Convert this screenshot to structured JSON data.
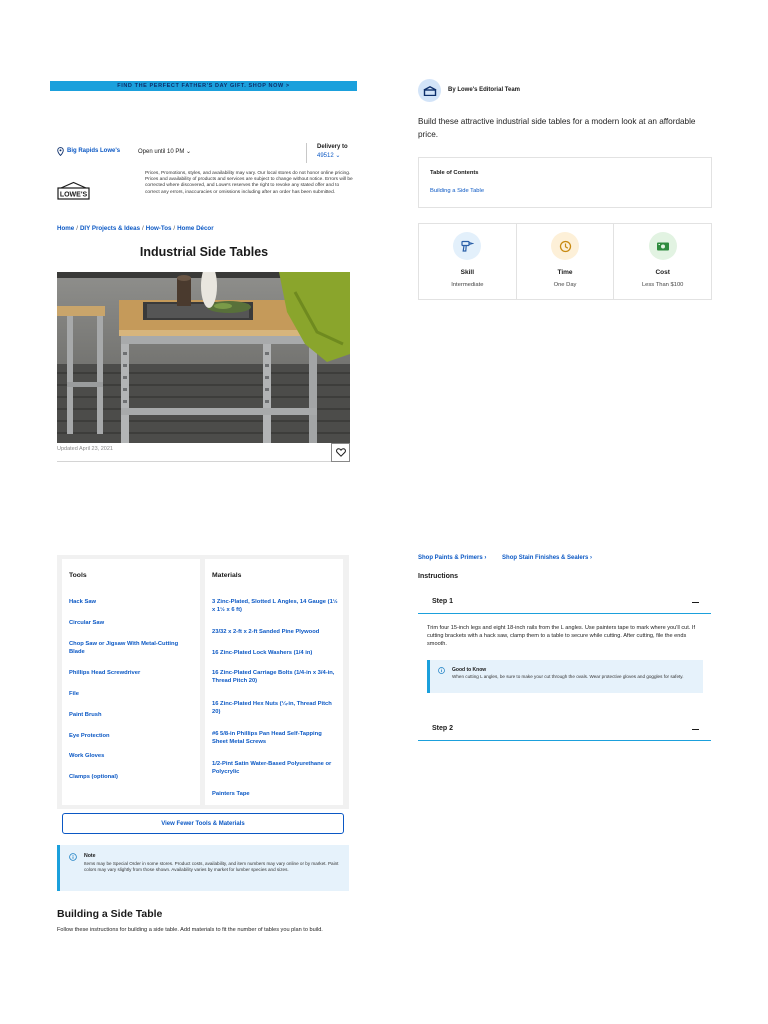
{
  "promo": {
    "text": "FIND THE PERFECT FATHER'S DAY GIFT. SHOP NOW >"
  },
  "store": {
    "name": "Big Rapids Lowe's",
    "hours": "Open until 10 PM",
    "delivery_label": "Delivery to",
    "zip": "49512"
  },
  "logo": {
    "text": "LOWE'S"
  },
  "disclaimer": "Prices, Promotions, styles, and availability may vary. Our local stores do not honor online pricing. Prices and availability of products and services are subject to change without notice. Errors will be corrected where discovered, and Lowe's reserves the right to revoke any stated offer and to correct any errors, inaccuracies or omissions including after an order has been submitted.",
  "breadcrumb": [
    "Home",
    "DIY Projects & Ideas",
    "How-Tos",
    "Home Décor"
  ],
  "title": "Industrial Side Tables",
  "updated": "Updated April 23, 2021",
  "author": "By Lowe's Editorial Team",
  "intro": "Build these attractive industrial side tables for a modern look at an affordable price.",
  "toc": {
    "title": "Table of Contents",
    "links": [
      "Building a Side Table"
    ]
  },
  "stats": [
    {
      "label": "Skill",
      "value": "Intermediate",
      "icon": "drill-icon",
      "color": "#e3f0fb"
    },
    {
      "label": "Time",
      "value": "One Day",
      "icon": "clock-icon",
      "color": "#fdf0d8"
    },
    {
      "label": "Cost",
      "value": "Less Than $100",
      "icon": "money-icon",
      "color": "#e2f3e2"
    }
  ],
  "tools": {
    "heading": "Tools",
    "items": [
      "Hack Saw",
      "Circular Saw",
      "Chop Saw or Jigsaw With Metal-Cutting Blade",
      "Phillips Head Screwdriver",
      "File",
      "Paint Brush",
      "Eye Protection",
      "Work Gloves",
      "Clamps (optional)"
    ]
  },
  "materials": {
    "heading": "Materials",
    "items": [
      "3 Zinc-Plated, Slotted L Angles, 14 Gauge (1½ x 1½ x 6 ft)",
      "23/32 x 2-ft x 2-ft Sanded Pine Plywood",
      "16 Zinc-Plated Lock Washers (1/4 in)",
      "16 Zinc-Plated Carriage Bolts (1/4-in x 3/4-in, Thread Pitch 20)",
      "16 Zinc-Plated Hex Nuts (¼-in, Thread Pitch 20)",
      "#6 5/8-in Phillips Pan Head Self-Tapping Sheet Metal Screws",
      "1/2-Pint Satin Water-Based Polyurethane or Polycrylic",
      "Painters Tape"
    ]
  },
  "view_fewer": "View Fewer Tools & Materials",
  "note": {
    "title": "Note",
    "text": "Items may be Special Order in some stores. Product costs, availability, and item numbers may vary online or by market. Paint colors may vary slightly from those shown. Availability varies by market for lumber species and sizes."
  },
  "section": {
    "title": "Building a Side Table",
    "text": "Follow these instructions for building a side table. Add materials to fit the number of tables you plan to build."
  },
  "shop_links": [
    "Shop Paints & Primers",
    "Shop Stain Finishes & Sealers"
  ],
  "instructions_label": "Instructions",
  "steps": [
    {
      "title": "Step 1",
      "text": "Trim four 15-inch legs and eight 18-inch rails from the L angles. Use painters tape to mark where you'll cut. If cutting brackets with a hack saw, clamp them to a table to secure while cutting. After cutting, file the ends smooth.",
      "know_title": "Good to Know",
      "know_text": "When cutting L angles, be sure to make your cut through the ovals. Wear protective gloves and goggles for safety."
    },
    {
      "title": "Step 2"
    }
  ],
  "colors": {
    "accent_blue": "#0b58c4",
    "promo_bg": "#1ba0dc",
    "info_bg": "#e6f2fb"
  }
}
